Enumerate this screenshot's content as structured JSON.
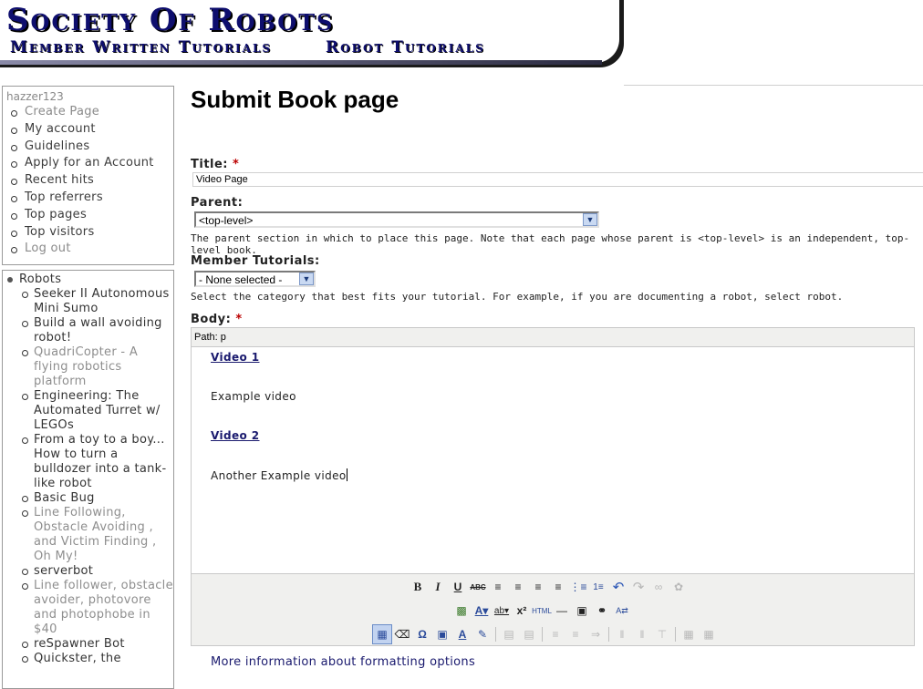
{
  "header": {
    "site_title": "Society Of Robots",
    "links": [
      "Member Written Tutorials",
      "Robot Tutorials"
    ]
  },
  "sidebar": {
    "username": "hazzer123",
    "user_menu": [
      {
        "label": "Create Page",
        "dim": true
      },
      {
        "label": "My account"
      },
      {
        "label": "Guidelines"
      },
      {
        "label": "Apply for an Account"
      },
      {
        "label": "Recent hits"
      },
      {
        "label": "Top referrers"
      },
      {
        "label": "Top pages"
      },
      {
        "label": "Top visitors"
      },
      {
        "label": "Log out",
        "dim": true
      }
    ],
    "tree_root": "Robots",
    "tree_items": [
      {
        "label": "Seeker II Autonomous Mini Sumo"
      },
      {
        "label": "Build a wall avoiding robot!"
      },
      {
        "label": "QuadriCopter - A flying robotics platform",
        "dim": true
      },
      {
        "label": "Engineering: The Automated Turret w/ LEGOs"
      },
      {
        "label": "From a toy to a boy... How to turn a bulldozer into a tank-like robot"
      },
      {
        "label": "Basic Bug"
      },
      {
        "label": "Line Following, Obstacle Avoiding , and Victim Finding , Oh My!",
        "dim": true
      },
      {
        "label": "serverbot"
      },
      {
        "label": "Line follower, obstacle avoider, photovore and photophobe in $40",
        "dim": true
      },
      {
        "label": "reSpawner Bot"
      },
      {
        "label": "Quickster, the"
      }
    ]
  },
  "main": {
    "page_title": "Submit Book page",
    "title_label": "Title:",
    "required_mark": "*",
    "title_value": "Video Page",
    "parent_label": "Parent:",
    "parent_selected": "<top-level>",
    "parent_desc": "The parent section in which to place this page. Note that each page whose parent is <top-level> is an independent, top-level book.",
    "tutorials_label": "Member Tutorials:",
    "tutorials_selected": "- None selected -",
    "tutorials_desc": "Select the category that best fits your tutorial. For example, if you are documenting a robot, select robot.",
    "body_label": "Body:",
    "editor": {
      "path": "Path: p",
      "content": [
        "Video 1",
        "Example video",
        "Video 2",
        "Another Example video"
      ]
    },
    "more_info": "More information about formatting options"
  },
  "toolbar": {
    "row1": [
      "bold-icon",
      "italic-icon",
      "underline-icon",
      "strikethrough-icon",
      "align-left-icon",
      "align-center-icon",
      "align-right-icon",
      "align-justify-icon",
      "bullet-list-icon",
      "numbered-list-icon",
      "undo-icon",
      "redo-icon",
      "link-icon",
      "unlink-icon"
    ],
    "row2": [
      "image-icon",
      "text-color-icon",
      "highlight-color-icon",
      "superscript-icon",
      "html-icon",
      "horizontal-rule-icon",
      "preview-icon",
      "find-icon",
      "replace-icon"
    ],
    "row3": [
      "table-icon",
      "cleanup-icon",
      "special-char-icon",
      "fullscreen-icon",
      "styles-icon",
      "edit-icon",
      "table-row-props-icon",
      "table-cell-props-icon",
      "insert-row-before-icon",
      "insert-row-after-icon",
      "delete-row-icon",
      "insert-col-before-icon",
      "insert-col-after-icon",
      "delete-col-icon",
      "split-cells-icon",
      "merge-cells-icon"
    ]
  },
  "colors": {
    "brand": "#0e0e6e",
    "link": "#1a1a6e",
    "required": "#b00000"
  }
}
